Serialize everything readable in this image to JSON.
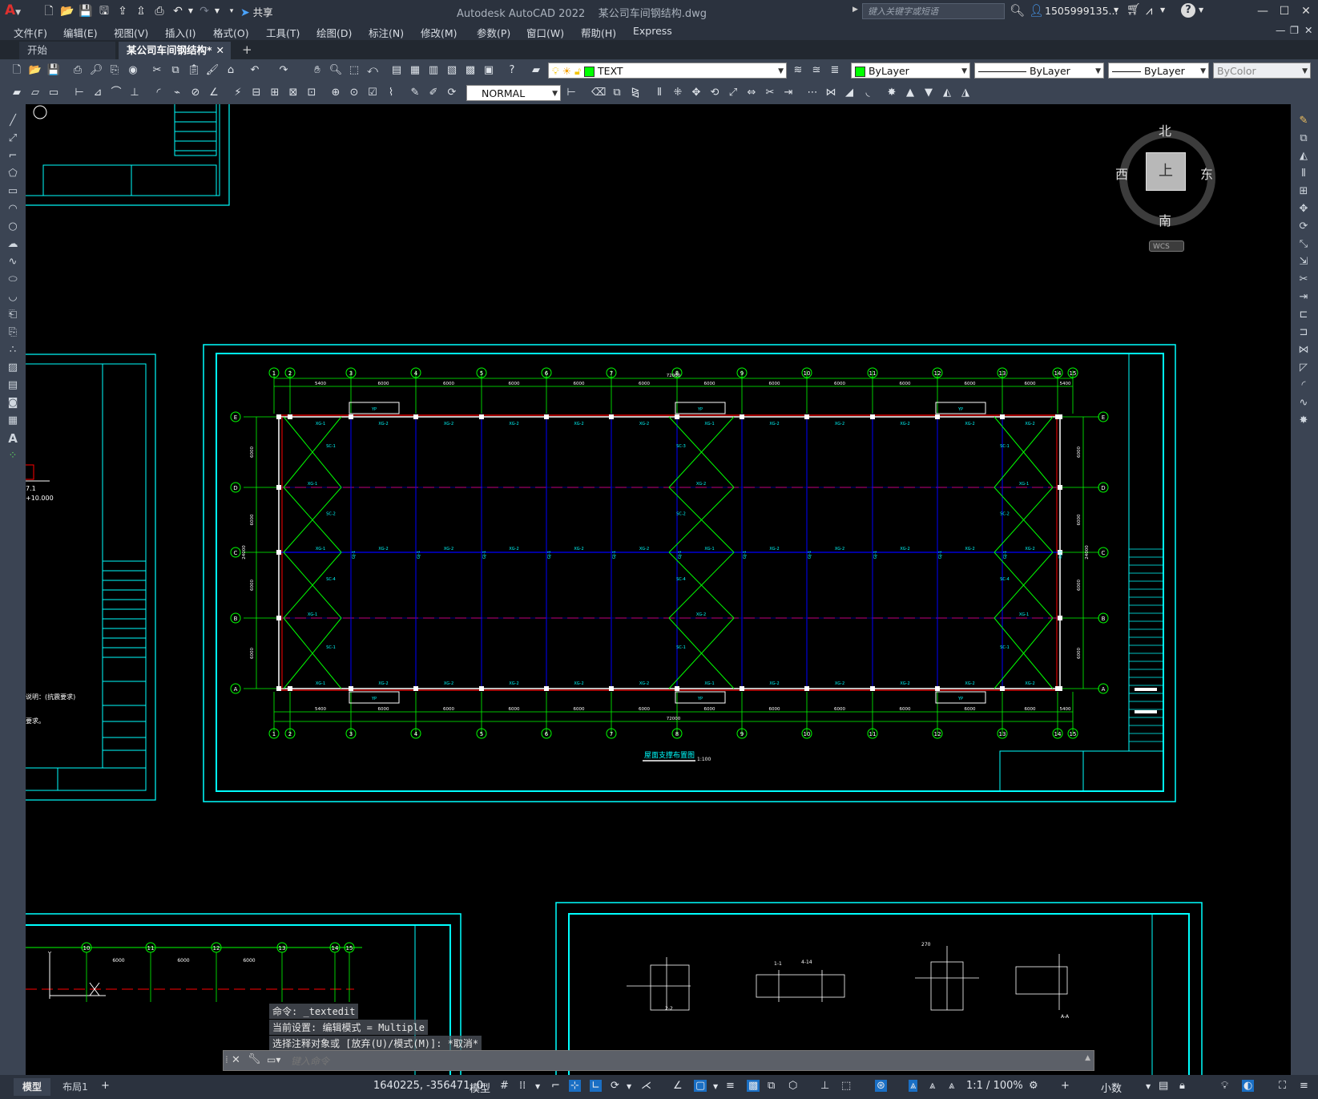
{
  "app": {
    "title": "Autodesk AutoCAD 2022",
    "filename": "某公司车间钢结构.dwg",
    "share_label": "共享",
    "search_placeholder": "键入关键字或短语",
    "user": "1505999135...",
    "logo": "A"
  },
  "menu": [
    "文件(F)",
    "编辑(E)",
    "视图(V)",
    "插入(I)",
    "格式(O)",
    "工具(T)",
    "绘图(D)",
    "标注(N)",
    "修改(M)",
    "参数(P)",
    "窗口(W)",
    "帮助(H)",
    "Express"
  ],
  "tabs": [
    {
      "label": "开始"
    },
    {
      "label": "某公司车间钢结构*"
    }
  ],
  "toolbar": {
    "layer_value": "TEXT",
    "color_value": "ByLayer",
    "linetype_value": "ByLayer",
    "lineweight_value": "ByLayer",
    "plotstyle_value": "ByColor",
    "dimstyle_value": "NORMAL"
  },
  "viewcube": {
    "north": "北",
    "south": "南",
    "east": "东",
    "west": "西",
    "top": "上",
    "wcs": "WCS"
  },
  "drawing": {
    "main_title": "屋面支撑布置图",
    "main_scale": "1:100",
    "total_length": "72000",
    "axes_top": [
      "1",
      "2",
      "3",
      "4",
      "5",
      "6",
      "7",
      "8",
      "9",
      "10",
      "11",
      "12",
      "13",
      "14",
      "15"
    ],
    "axes_side": [
      "E",
      "D",
      "C",
      "B",
      "A"
    ],
    "bay_dims": [
      "5400",
      "6000",
      "6000",
      "6000",
      "6000",
      "6000",
      "6000",
      "6000",
      "6000",
      "6000",
      "6000",
      "6000",
      "5400"
    ],
    "side_dims": [
      "6000",
      "6000",
      "6000",
      "6000"
    ],
    "side_total": "24000",
    "member_labels": {
      "xg1": "XG-1",
      "xg2": "XG-2",
      "sc1": "SC-1",
      "sc2": "SC-2",
      "sc3": "SC-3",
      "sc4": "SC-4",
      "gj": "GJ-1",
      "yp": "YP"
    },
    "left_sheet_text": [
      "7.1",
      "+10.000",
      "说明：(抗震要求)",
      "要求。"
    ],
    "bottom_sheet_text": [
      "6000",
      "6000",
      "6000",
      "12",
      "13",
      "14",
      "15",
      "10",
      "11",
      "Y"
    ],
    "detail_labels": [
      "A-A",
      "1-1",
      "2-2",
      "270",
      "4-14"
    ]
  },
  "command": {
    "history": [
      "命令: _textedit",
      "当前设置: 编辑模式 = Multiple",
      "选择注释对象或 [放弃(U)/模式(M)]: *取消*"
    ],
    "placeholder": "键入命令"
  },
  "statusbar": {
    "model_tab": "模型",
    "layout_tab": "布局1",
    "coords": "1640225, -356471, 0",
    "space": "模型",
    "scale": "1:1 / 100%",
    "units": "小数"
  },
  "colors": {
    "cyan": "#00ffff",
    "green": "#00ff00",
    "red": "#ff0000",
    "blue": "#0000ff",
    "white": "#ffffff",
    "titlebar": "#2b323e",
    "toolbar": "#3b4453"
  }
}
